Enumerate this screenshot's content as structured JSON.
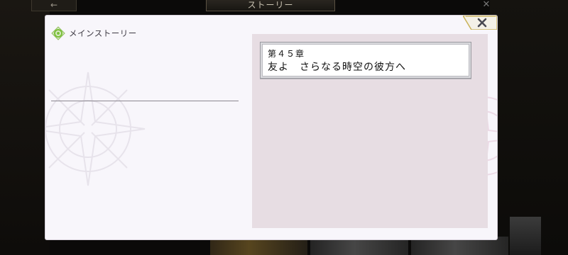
{
  "topbar": {
    "title": "ストーリー",
    "back_glyph": "←",
    "close_glyph": "✕"
  },
  "modal": {
    "section_icon": "gem-target-icon",
    "section_title": "メインストーリー",
    "close_icon": "close-icon",
    "close_glyph": "✕",
    "chapter": {
      "number": "第４５章",
      "title": "友よ　さらなる時空の彼方へ"
    }
  },
  "colors": {
    "modal_bg": "#f8f6fb",
    "panel_bg": "#e7dde3",
    "accent_gold": "#c9b25a",
    "gem_green": "#7bbf3a"
  }
}
